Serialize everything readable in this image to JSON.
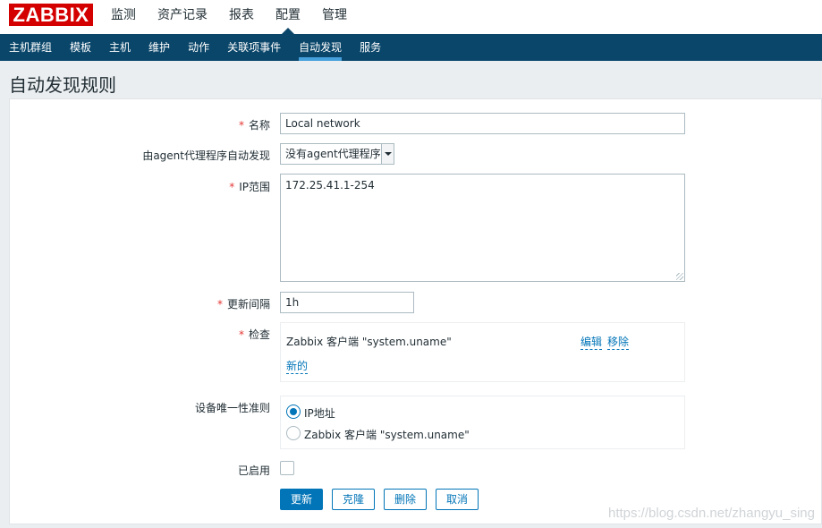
{
  "logo": "ZABBIX",
  "main_menu": [
    {
      "label": "监测"
    },
    {
      "label": "资产记录"
    },
    {
      "label": "报表"
    },
    {
      "label": "配置"
    },
    {
      "label": "管理"
    }
  ],
  "sub_menu": [
    {
      "label": "主机群组"
    },
    {
      "label": "模板"
    },
    {
      "label": "主机"
    },
    {
      "label": "维护"
    },
    {
      "label": "动作"
    },
    {
      "label": "关联项事件"
    },
    {
      "label": "自动发现"
    },
    {
      "label": "服务"
    }
  ],
  "page_title": "自动发现规则",
  "form": {
    "required_mark": "*",
    "name_label": "名称",
    "name_value": "Local network",
    "proxy_label": "由agent代理程序自动发现",
    "proxy_value": "没有agent代理程序",
    "ip_range_label": "IP范围",
    "ip_range_value": "172.25.41.1-254",
    "interval_label": "更新间隔",
    "interval_value": "1h",
    "checks_label": "检查",
    "check_item": "Zabbix 客户端 \"system.uname\"",
    "edit_link": "编辑",
    "remove_link": "移除",
    "new_link": "新的",
    "uniqueness_label": "设备唯一性准则",
    "uniqueness_options": [
      {
        "label": "IP地址",
        "checked": true
      },
      {
        "label": "Zabbix 客户端 \"system.uname\"",
        "checked": false
      }
    ],
    "enabled_label": "已启用",
    "enabled": false
  },
  "buttons": {
    "update": "更新",
    "clone": "克隆",
    "delete": "删除",
    "cancel": "取消"
  },
  "watermark": "https://blog.csdn.net/zhangyu_sing",
  "colors": {
    "logo_red": "#d40000",
    "nav_dark": "#0a466a",
    "accent": "#0275b8",
    "active_tab": "#45a0db",
    "required": "#e33734"
  }
}
